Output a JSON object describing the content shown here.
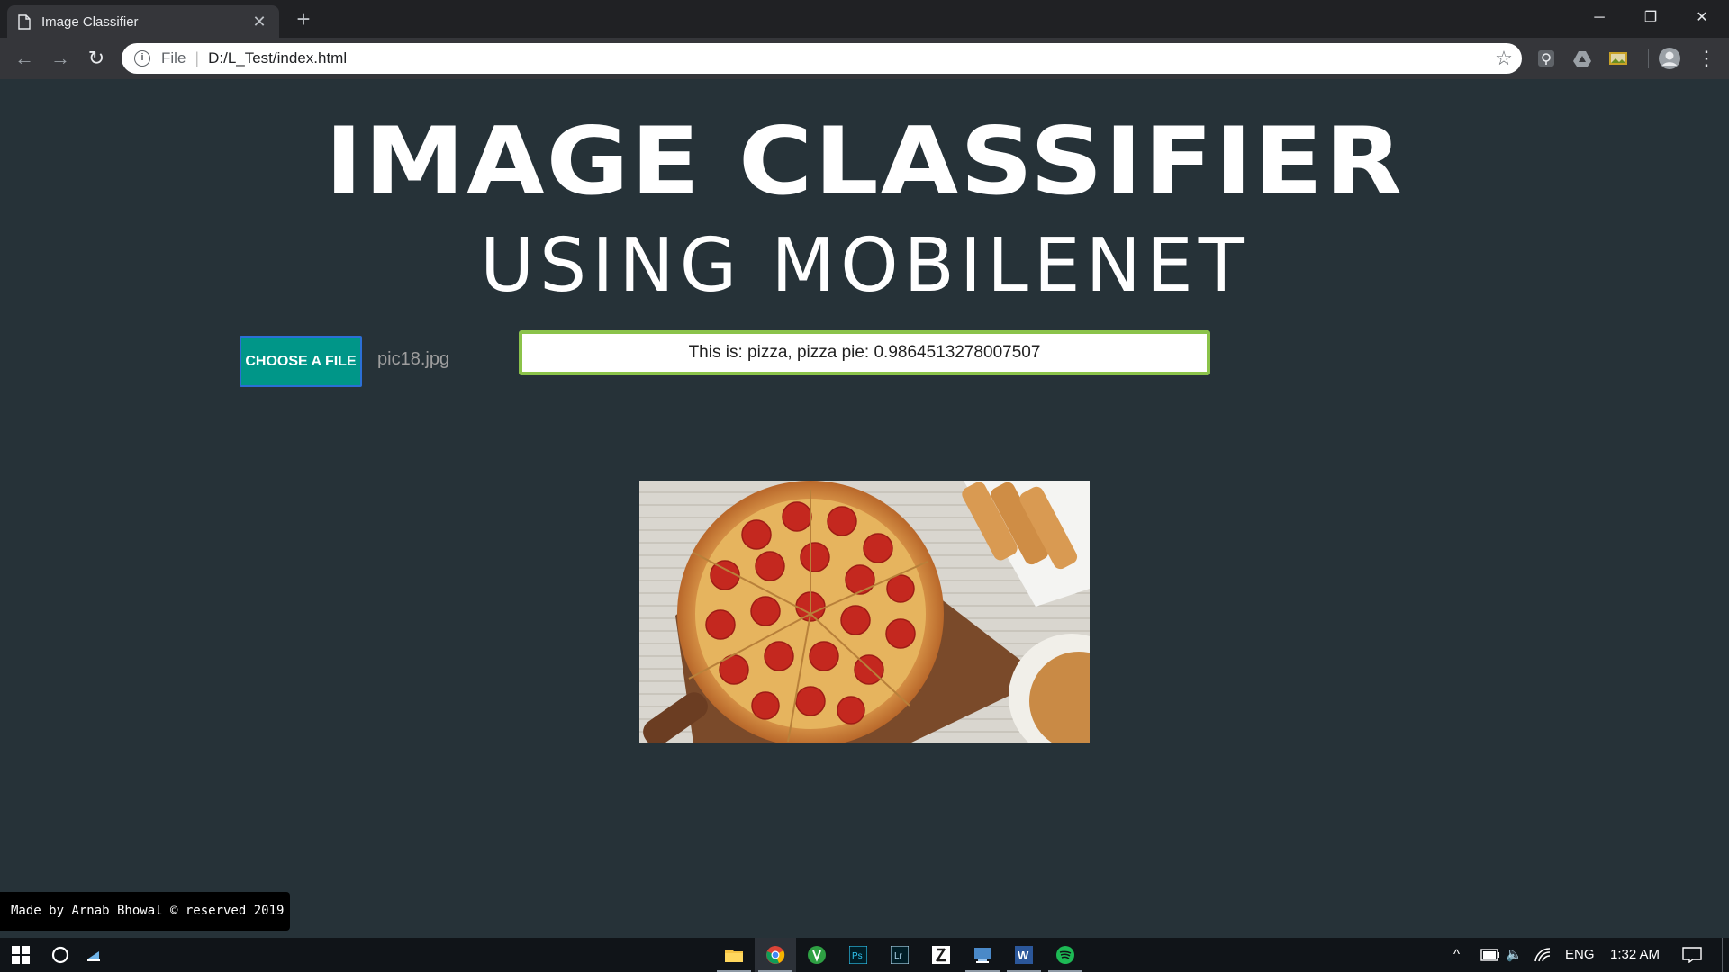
{
  "browser": {
    "tab_title": "Image Classifier",
    "address_scheme": "File",
    "address_url": "D:/L_Test/index.html"
  },
  "page": {
    "title": "IMAGE CLASSIFIER",
    "subtitle": "USING MOBILENET",
    "choose_button_label": "CHOOSE A FILE",
    "file_name": "pic18.jpg",
    "result_text": "This is: pizza, pizza pie: 0.9864513278007507",
    "footer_text": "Made by Arnab Bhowal © reserved 2019"
  },
  "colors": {
    "page_background": "#263238",
    "button_teal": "#009688",
    "result_border": "#8bc34a"
  },
  "taskbar": {
    "language": "ENG",
    "time": "1:32 AM",
    "pinned_icons": [
      "file-explorer-icon",
      "chrome-icon",
      "app-icon",
      "photoshop-icon",
      "lightroom-icon",
      "sublime-icon",
      "app-icon",
      "word-icon",
      "spotify-icon"
    ]
  }
}
